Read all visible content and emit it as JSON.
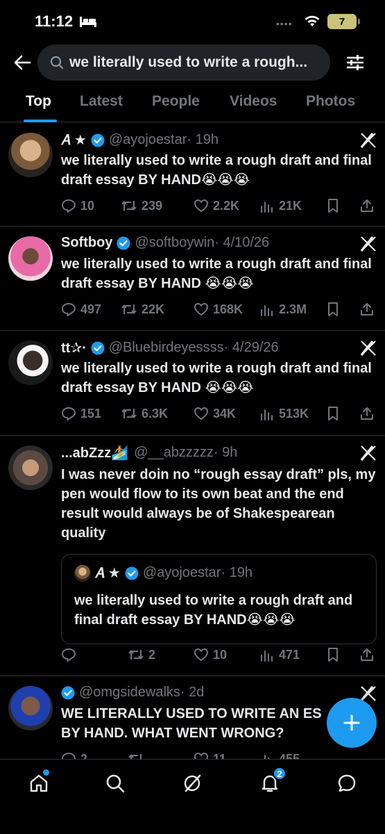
{
  "status": {
    "time": "11:12",
    "battery": "7"
  },
  "search": {
    "query": "we literally used to write a rough..."
  },
  "tabs": [
    "Top",
    "Latest",
    "People",
    "Videos",
    "Photos"
  ],
  "colors": {
    "accent": "#1d9bf0",
    "muted": "#71767b",
    "divider": "#2f3336"
  },
  "posts": [
    {
      "name": "𝐴 ★",
      "handle": "@ayojoestar",
      "time": "· 19h",
      "text": "we literally used to write a rough draft and final draft essay BY HAND",
      "emoji": "😭😭😭",
      "replies": "10",
      "reposts": "239",
      "likes": "2.2K",
      "views": "21K"
    },
    {
      "name": "Softboy",
      "handle": "@softboywin",
      "time": "· 4/10/26",
      "text": "we literally used to write a rough draft and final draft essay BY HAND",
      "emoji": " 😭😭😭",
      "replies": "497",
      "reposts": "22K",
      "likes": "168K",
      "views": "2.3M"
    },
    {
      "name": "tt✰·",
      "handle": "@Bluebirdeyessss",
      "time": "· 4/29/26",
      "text": "we literally used to write a rough draft and final draft essay BY HAND",
      "emoji": " 😭😭😭",
      "replies": "151",
      "reposts": "6.3K",
      "likes": "34K",
      "views": "513K"
    },
    {
      "name": "...abZzz🏄",
      "handle": "@__abzzzzz",
      "time": "· 9h",
      "text": "I was never doin no “rough essay draft” pls, my pen would flow to its own beat and the end result would always be of Shakespearean quality",
      "quote": {
        "name": "𝐴 ★",
        "handle": "@ayojoestar",
        "time": "· 19h",
        "text": "we literally used to write a rough draft and final draft essay BY HAND",
        "emoji": "😭😭😭"
      },
      "replies": "",
      "reposts": "2",
      "likes": "10",
      "views": "471"
    },
    {
      "name": "",
      "handle": "@omgsidewalks",
      "time": "· 2d",
      "text": "WE LITERALLY USED TO WRITE AN ES BY HAND. WHAT WENT WRONG?",
      "replies": "2",
      "reposts": "",
      "likes": "11",
      "views": "455"
    }
  ],
  "nav": {
    "notifications_count": "2"
  }
}
